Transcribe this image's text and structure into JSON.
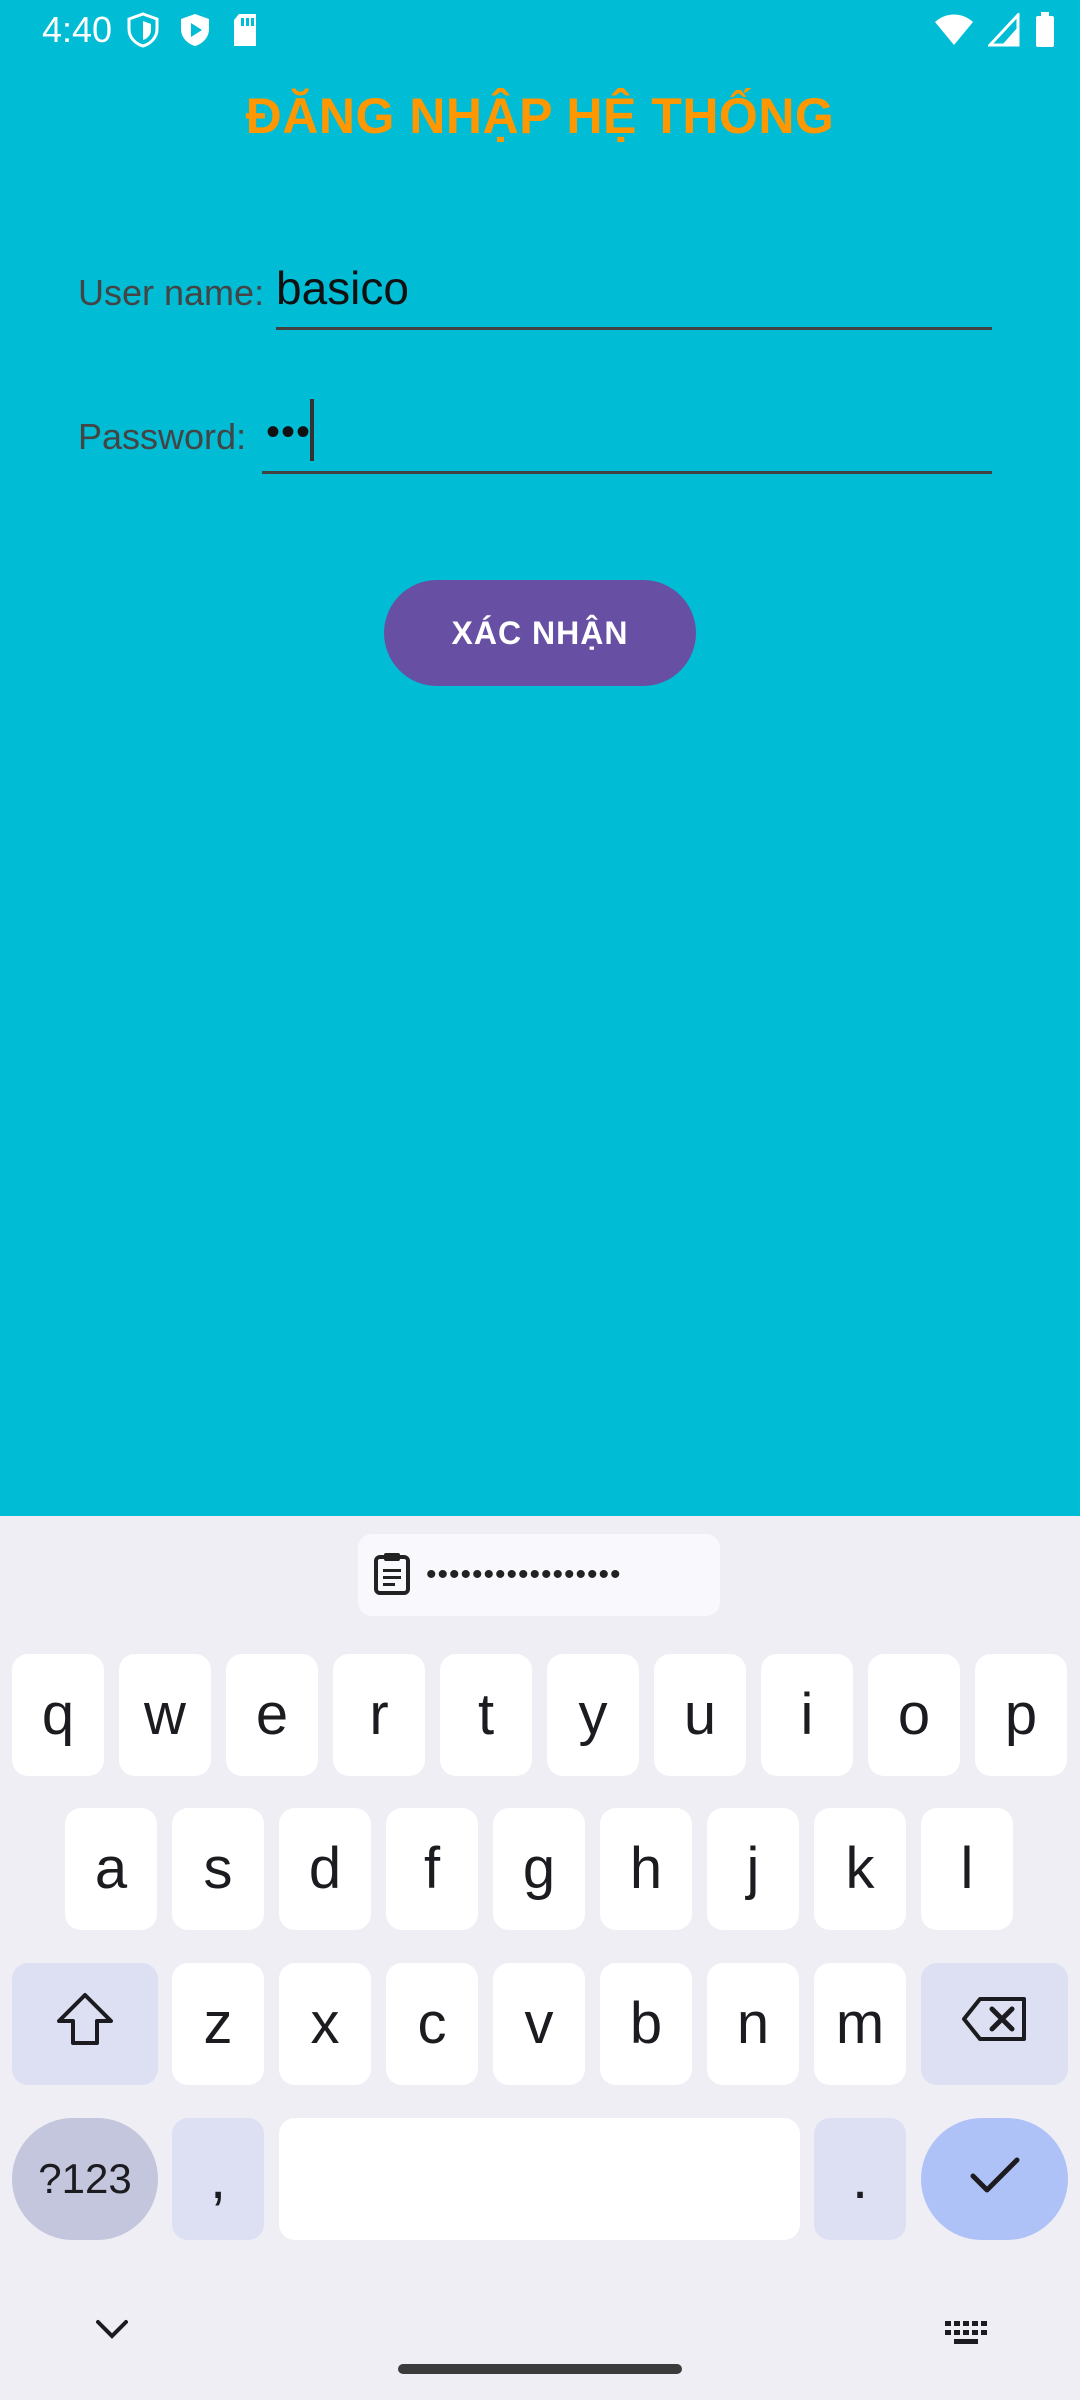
{
  "status_bar": {
    "time": "4:40"
  },
  "title": "ĐĂNG NHẬP HỆ THỐNG",
  "form": {
    "username_label": "User name:",
    "username_value": "basico",
    "password_label": "Password:",
    "password_value_display": "•••"
  },
  "confirm_label": "XÁC NHẬN",
  "keyboard": {
    "clipboard_suggestion": "•••••••••••••••••",
    "row1": [
      "q",
      "w",
      "e",
      "r",
      "t",
      "y",
      "u",
      "i",
      "o",
      "p"
    ],
    "row2": [
      "a",
      "s",
      "d",
      "f",
      "g",
      "h",
      "j",
      "k",
      "l"
    ],
    "row3": [
      "z",
      "x",
      "c",
      "v",
      "b",
      "n",
      "m"
    ],
    "symbols_label": "?123",
    "comma_label": ",",
    "period_label": "."
  },
  "colors": {
    "background": "#00BCD4",
    "title": "#FF9800",
    "button": "#6750A4"
  },
  "icons": [
    "shield-icon",
    "play-shield-icon",
    "sd-card-icon",
    "wifi-icon",
    "signal-icon",
    "battery-icon",
    "clipboard-icon",
    "shift-icon",
    "backspace-icon",
    "check-icon",
    "chevron-down-icon",
    "keyboard-icon"
  ]
}
